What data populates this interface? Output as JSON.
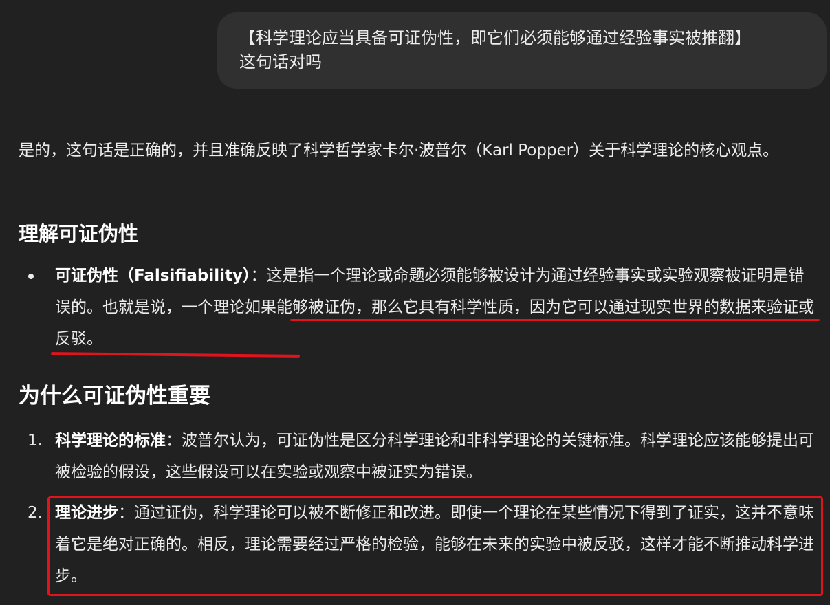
{
  "user_message": {
    "line1": "【科学理论应当具备可证伪性，即它们必须能够通过经验事实被推翻】",
    "line2": "这句话对吗"
  },
  "answer": {
    "intro": "是的，这句话是正确的，并且准确反映了科学哲学家卡尔·波普尔（Karl Popper）关于科学理论的核心观点。",
    "section1": {
      "heading": "理解可证伪性",
      "bullets": [
        {
          "term": "可证伪性（Falsifiability）",
          "text": "：这是指一个理论或命题必须能够被设计为通过经验事实或实验观察被证明是错误的。也就是说，一个理论如果能够被证伪，那么它具有科学性质，因为它可以通过现实世界的数据来验证或反驳。"
        }
      ]
    },
    "section2": {
      "heading": "为什么可证伪性重要",
      "items": [
        {
          "number": "1.",
          "term": "科学理论的标准",
          "text": "：波普尔认为，可证伪性是区分科学理论和非科学理论的关键标准。科学理论应该能够提出可被检验的假设，这些假设可以在实验或观察中被证实为错误。"
        },
        {
          "number": "2.",
          "term": "理论进步",
          "text": "：通过证伪，科学理论可以被不断修正和改进。即使一个理论在某些情况下得到了证实，这并不意味着它是绝对正确的。相反，理论需要经过严格的检验，能够在未来的实验中被反驳，这样才能不断推动科学进步。"
        }
      ]
    }
  },
  "annotations": {
    "color": "#e1141e"
  }
}
